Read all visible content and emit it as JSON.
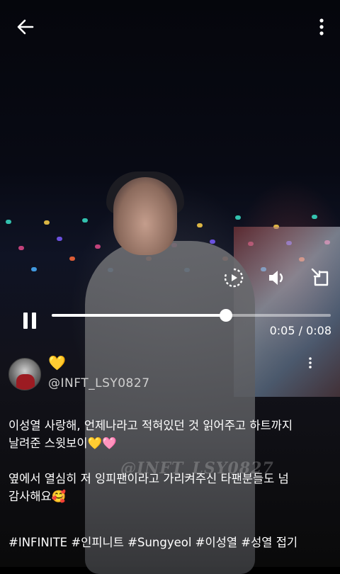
{
  "player": {
    "elapsed": "0:05",
    "duration": "0:08",
    "time_display": "0:05 / 0:08",
    "progress_fraction": 0.625,
    "state": "playing"
  },
  "video": {
    "watermark": "@INFT_LSY0827"
  },
  "post": {
    "display_name": "💛",
    "handle": "@INFT_LSY0827",
    "caption_line1": "이성열 사랑해, 언제나라고 적혀있던 것 읽어주고 하트까지",
    "caption_line2": "날려준 스윗보이💛🩷",
    "caption_line3": "옆에서 열심히 저 잉피팬이라고 가리켜주신 타팬분들도 넘",
    "caption_line4": "감사해요🥰",
    "hashtags": "#INFINITE #인피니트 #Sungyeol #이성열 #성열 접기"
  },
  "icons": {
    "back": "arrow-left-icon",
    "more": "more-vertical-icon",
    "replay": "replay-icon",
    "volume": "volume-icon",
    "exit_fullscreen": "exit-fullscreen-icon",
    "pause": "pause-icon"
  },
  "colors": {
    "text": "#ffffff",
    "handle": "#cfcfcf",
    "track": "#ffffff73"
  }
}
